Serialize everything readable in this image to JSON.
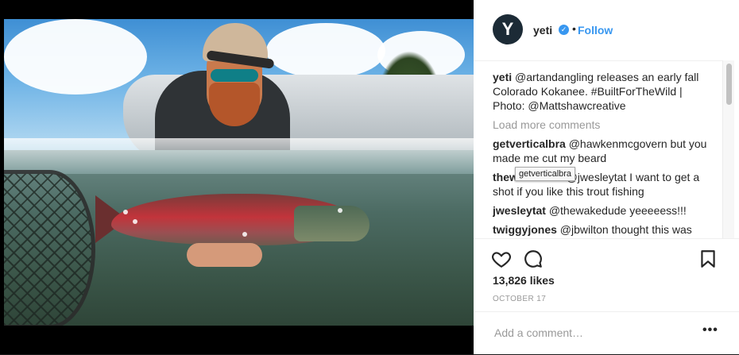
{
  "post": {
    "username": "yeti",
    "avatar_letter": "Y",
    "follow_label": "Follow",
    "dot": "•",
    "verified_mark": "✓",
    "icons": [
      "heart-icon",
      "comment-icon",
      "bookmark-icon",
      "verified-badge-icon",
      "more-options-icon"
    ],
    "colors": {
      "accent": "#3897f0",
      "avatar_bg": "#1c2b36",
      "muted": "#999999",
      "text": "#262626"
    }
  },
  "caption": {
    "user": "yeti",
    "text": "@artandangling releases an early fall Colorado Kokanee. #BuiltForTheWild | Photo: @Mattshawcreative"
  },
  "load_more": "Load more comments",
  "comments": [
    {
      "user": "getverticalbra",
      "text": "@hawkenmcgovern but you made me cut my beard"
    },
    {
      "user": "thewakedude",
      "text": "@jwesleytat I want to get a shot if you like this trout fishing"
    },
    {
      "user": "jwesleytat",
      "text": "@thewakedude yeeeeess!!!"
    },
    {
      "user": "twiggyjones",
      "text": "@jbwilton thought this was"
    }
  ],
  "tooltip": "getverticalbra",
  "likes": "13,826 likes",
  "date": "OCTOBER 17",
  "comment_placeholder": "Add a comment…",
  "more_label": "•••"
}
